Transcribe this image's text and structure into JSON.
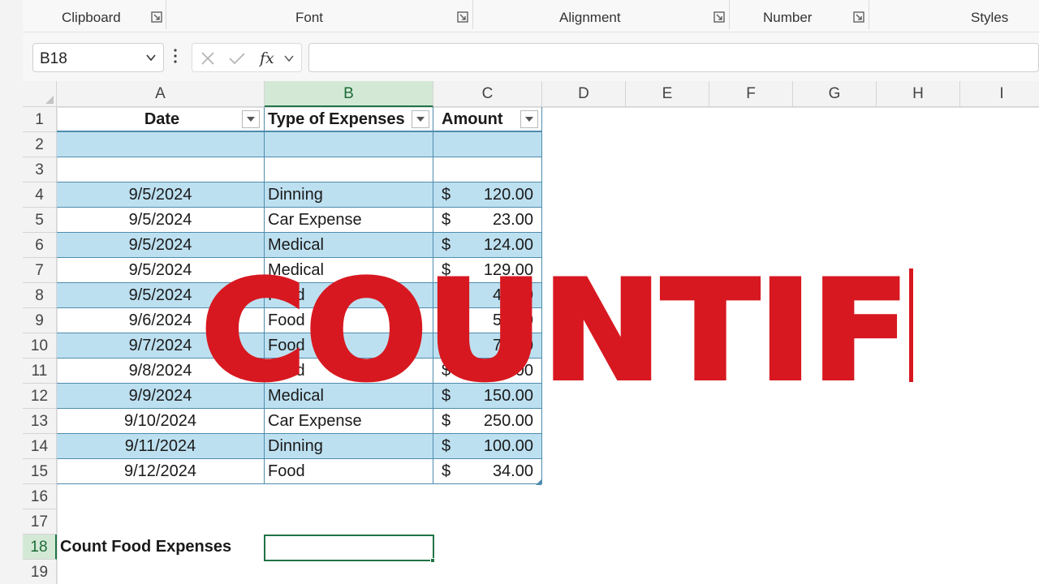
{
  "ribbon": {
    "groups": [
      {
        "label": "Clipboard"
      },
      {
        "label": "Font"
      },
      {
        "label": "Alignment"
      },
      {
        "label": "Number"
      },
      {
        "label": "Styles"
      }
    ]
  },
  "formula_bar": {
    "name_box": "B18",
    "formula": ""
  },
  "columns": [
    "A",
    "B",
    "C",
    "D",
    "E",
    "F",
    "G",
    "H",
    "I"
  ],
  "selected_column": "B",
  "rows": [
    "1",
    "2",
    "3",
    "4",
    "5",
    "6",
    "7",
    "8",
    "9",
    "10",
    "11",
    "12",
    "13",
    "14",
    "15",
    "16",
    "17",
    "18",
    "19"
  ],
  "selected_row": "18",
  "table": {
    "headers": [
      "Date",
      "Type of Expenses",
      "Amount"
    ],
    "currency_symbol": "$",
    "records": [
      {
        "date": "9/5/2024",
        "type": "Dinning",
        "amount": "120.00"
      },
      {
        "date": "9/5/2024",
        "type": "Car Expense",
        "amount": "23.00"
      },
      {
        "date": "9/5/2024",
        "type": "Medical",
        "amount": "124.00"
      },
      {
        "date": "9/5/2024",
        "type": "Medical",
        "amount": "129.00"
      },
      {
        "date": "9/5/2024",
        "type": "Food",
        "amount": "45.00"
      },
      {
        "date": "9/6/2024",
        "type": "Food",
        "amount": "56.00"
      },
      {
        "date": "9/7/2024",
        "type": "Food",
        "amount": "78.00"
      },
      {
        "date": "9/8/2024",
        "type": "Food",
        "amount": "12.00"
      },
      {
        "date": "9/9/2024",
        "type": "Medical",
        "amount": "150.00"
      },
      {
        "date": "9/10/2024",
        "type": "Car Expense",
        "amount": "250.00"
      },
      {
        "date": "9/11/2024",
        "type": "Dinning",
        "amount": "100.00"
      },
      {
        "date": "9/12/2024",
        "type": "Food",
        "amount": "34.00"
      }
    ]
  },
  "summary": {
    "label": "Count Food Expenses",
    "value": ""
  },
  "overlay_title": "COUNTIF",
  "colors": {
    "band": "#bde0f0",
    "table_border": "#4f8cad",
    "selection": "#217346",
    "overlay_text": "#d81820"
  }
}
